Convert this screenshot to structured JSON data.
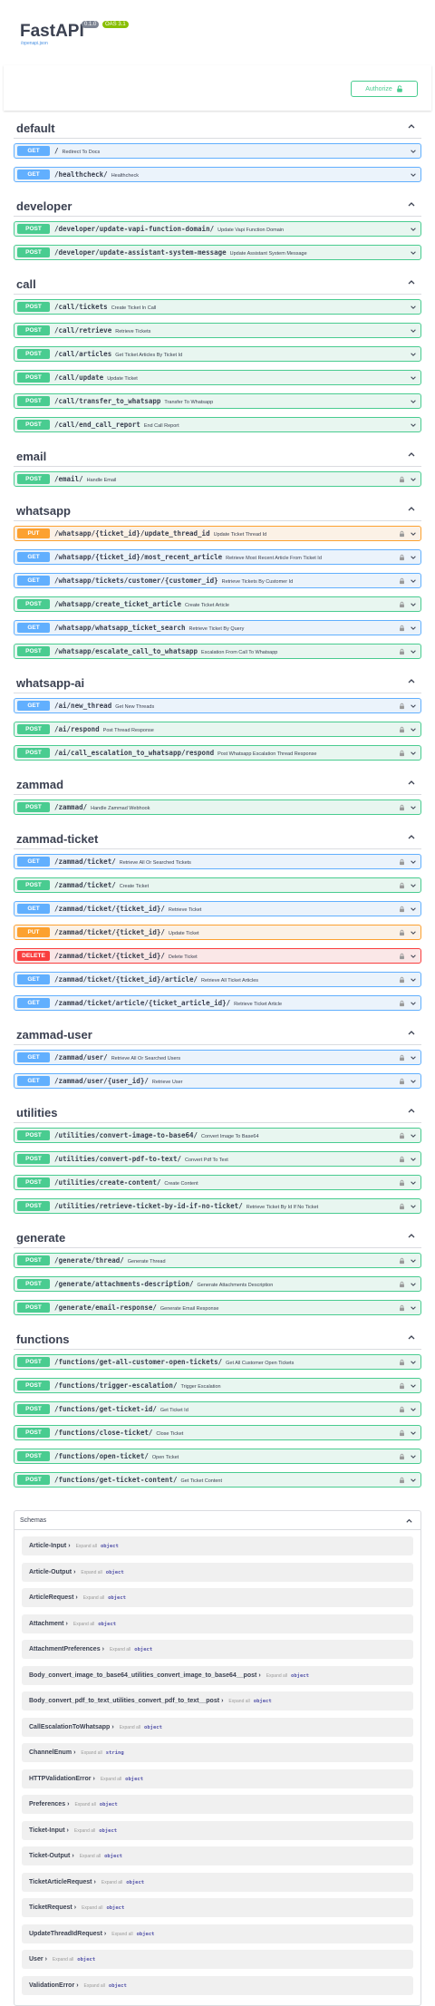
{
  "info": {
    "title": "FastAPI",
    "version": "0.1.0",
    "oas": "OAS 3.1",
    "link": "/openapi.json"
  },
  "authorize_label": "Authorize",
  "sections": [
    {
      "name": "default",
      "ops": [
        {
          "method": "GET",
          "path": "/",
          "summary": "Redirect To Docs",
          "lock": false
        },
        {
          "method": "GET",
          "path": "/healthcheck/",
          "summary": "Healthcheck",
          "lock": false
        }
      ]
    },
    {
      "name": "developer",
      "ops": [
        {
          "method": "POST",
          "path": "/developer/update-vapi-function-domain/",
          "summary": "Update Vapi Function Domain",
          "lock": false
        },
        {
          "method": "POST",
          "path": "/developer/update-assistant-system-message",
          "summary": "Update Assistant System Message",
          "lock": false
        }
      ]
    },
    {
      "name": "call",
      "ops": [
        {
          "method": "POST",
          "path": "/call/tickets",
          "summary": "Create Ticket In Call",
          "lock": false
        },
        {
          "method": "POST",
          "path": "/call/retrieve",
          "summary": "Retrieve Tickets",
          "lock": false
        },
        {
          "method": "POST",
          "path": "/call/articles",
          "summary": "Get Ticket Articles By Ticket Id",
          "lock": false
        },
        {
          "method": "POST",
          "path": "/call/update",
          "summary": "Update Ticket",
          "lock": false
        },
        {
          "method": "POST",
          "path": "/call/transfer_to_whatsapp",
          "summary": "Transfer To Whatsapp",
          "lock": false
        },
        {
          "method": "POST",
          "path": "/call/end_call_report",
          "summary": "End Call Report",
          "lock": false
        }
      ]
    },
    {
      "name": "email",
      "ops": [
        {
          "method": "POST",
          "path": "/email/",
          "summary": "Handle Email",
          "lock": true
        }
      ]
    },
    {
      "name": "whatsapp",
      "ops": [
        {
          "method": "PUT",
          "path": "/whatsapp/{ticket_id}/update_thread_id",
          "summary": "Update Ticket Thread Id",
          "lock": true
        },
        {
          "method": "GET",
          "path": "/whatsapp/{ticket_id}/most_recent_article",
          "summary": "Retrieve Most Recent Article From Ticket Id",
          "lock": true
        },
        {
          "method": "GET",
          "path": "/whatsapp/tickets/customer/{customer_id}",
          "summary": "Retrieve Tickets By Customer Id",
          "lock": true
        },
        {
          "method": "POST",
          "path": "/whatsapp/create_ticket_article",
          "summary": "Create Ticket Article",
          "lock": true
        },
        {
          "method": "GET",
          "path": "/whatsapp/whatsapp_ticket_search",
          "summary": "Retrieve Ticket By Query",
          "lock": true
        },
        {
          "method": "POST",
          "path": "/whatsapp/escalate_call_to_whatsapp",
          "summary": "Escalation From Call To Whatsapp",
          "lock": true
        }
      ]
    },
    {
      "name": "whatsapp-ai",
      "ops": [
        {
          "method": "GET",
          "path": "/ai/new_thread",
          "summary": "Get New Threads",
          "lock": true
        },
        {
          "method": "POST",
          "path": "/ai/respond",
          "summary": "Post Thread Response",
          "lock": true
        },
        {
          "method": "POST",
          "path": "/ai/call_escalation_to_whatsapp/respond",
          "summary": "Post Whatsapp Escalation Thread Response",
          "lock": true
        }
      ]
    },
    {
      "name": "zammad",
      "ops": [
        {
          "method": "POST",
          "path": "/zammad/",
          "summary": "Handle Zammad Webhook",
          "lock": true
        }
      ]
    },
    {
      "name": "zammad-ticket",
      "ops": [
        {
          "method": "GET",
          "path": "/zammad/ticket/",
          "summary": "Retrieve All Or Searched Tickets",
          "lock": true
        },
        {
          "method": "POST",
          "path": "/zammad/ticket/",
          "summary": "Create Ticket",
          "lock": true
        },
        {
          "method": "GET",
          "path": "/zammad/ticket/{ticket_id}/",
          "summary": "Retrieve Ticket",
          "lock": true
        },
        {
          "method": "PUT",
          "path": "/zammad/ticket/{ticket_id}/",
          "summary": "Update Ticket",
          "lock": true
        },
        {
          "method": "DELETE",
          "path": "/zammad/ticket/{ticket_id}/",
          "summary": "Delete Ticket",
          "lock": true
        },
        {
          "method": "GET",
          "path": "/zammad/ticket/{ticket_id}/article/",
          "summary": "Retrieve All Ticket Articles",
          "lock": true
        },
        {
          "method": "GET",
          "path": "/zammad/ticket/article/{ticket_article_id}/",
          "summary": "Retrieve Ticket Article",
          "lock": true
        }
      ]
    },
    {
      "name": "zammad-user",
      "ops": [
        {
          "method": "GET",
          "path": "/zammad/user/",
          "summary": "Retrieve All Or Searched Users",
          "lock": true
        },
        {
          "method": "GET",
          "path": "/zammad/user/{user_id}/",
          "summary": "Retrieve User",
          "lock": true
        }
      ]
    },
    {
      "name": "utilities",
      "ops": [
        {
          "method": "POST",
          "path": "/utilities/convert-image-to-base64/",
          "summary": "Convert Image To Base64",
          "lock": true
        },
        {
          "method": "POST",
          "path": "/utilities/convert-pdf-to-text/",
          "summary": "Convert Pdf To Text",
          "lock": true
        },
        {
          "method": "POST",
          "path": "/utilities/create-content/",
          "summary": "Create Content",
          "lock": true
        },
        {
          "method": "POST",
          "path": "/utilities/retrieve-ticket-by-id-if-no-ticket/",
          "summary": "Retrieve Ticket By Id If No Ticket",
          "lock": true
        }
      ]
    },
    {
      "name": "generate",
      "ops": [
        {
          "method": "POST",
          "path": "/generate/thread/",
          "summary": "Generate Thread",
          "lock": true
        },
        {
          "method": "POST",
          "path": "/generate/attachments-description/",
          "summary": "Generate Attachments Description",
          "lock": true
        },
        {
          "method": "POST",
          "path": "/generate/email-response/",
          "summary": "Generate Email Response",
          "lock": true
        }
      ]
    },
    {
      "name": "functions",
      "ops": [
        {
          "method": "POST",
          "path": "/functions/get-all-customer-open-tickets/",
          "summary": "Get All Customer Open Tickets",
          "lock": true
        },
        {
          "method": "POST",
          "path": "/functions/trigger-escalation/",
          "summary": "Trigger Escalation",
          "lock": true
        },
        {
          "method": "POST",
          "path": "/functions/get-ticket-id/",
          "summary": "Get Ticket Id",
          "lock": true
        },
        {
          "method": "POST",
          "path": "/functions/close-ticket/",
          "summary": "Close Ticket",
          "lock": true
        },
        {
          "method": "POST",
          "path": "/functions/open-ticket/",
          "summary": "Open Ticket",
          "lock": true
        },
        {
          "method": "POST",
          "path": "/functions/get-ticket-content/",
          "summary": "Get Ticket Content",
          "lock": true
        }
      ]
    }
  ],
  "schemas": {
    "title": "Schemas",
    "expand_label": "Expand all",
    "items": [
      {
        "name": "Article-Input",
        "type": "object"
      },
      {
        "name": "Article-Output",
        "type": "object"
      },
      {
        "name": "ArticleRequest",
        "type": "object"
      },
      {
        "name": "Attachment",
        "type": "object"
      },
      {
        "name": "AttachmentPreferences",
        "type": "object"
      },
      {
        "name": "Body_convert_image_to_base64_utilities_convert_image_to_base64__post",
        "type": "object"
      },
      {
        "name": "Body_convert_pdf_to_text_utilities_convert_pdf_to_text__post",
        "type": "object"
      },
      {
        "name": "CallEscalationToWhatsapp",
        "type": "object"
      },
      {
        "name": "ChannelEnum",
        "type": "string"
      },
      {
        "name": "HTTPValidationError",
        "type": "object"
      },
      {
        "name": "Preferences",
        "type": "object"
      },
      {
        "name": "Ticket-Input",
        "type": "object"
      },
      {
        "name": "Ticket-Output",
        "type": "object"
      },
      {
        "name": "TicketArticleRequest",
        "type": "object"
      },
      {
        "name": "TicketRequest",
        "type": "object"
      },
      {
        "name": "UpdateThreadIdRequest",
        "type": "object"
      },
      {
        "name": "User",
        "type": "object"
      },
      {
        "name": "ValidationError",
        "type": "object"
      }
    ]
  }
}
